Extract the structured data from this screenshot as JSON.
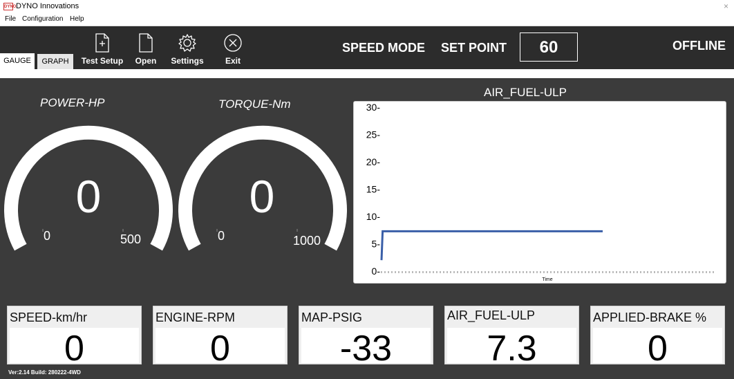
{
  "window": {
    "title": "DYNO Innovations",
    "logo_text": "DYNO",
    "close_glyph": "×"
  },
  "menu": [
    "File",
    "Configuration",
    "Help"
  ],
  "tabs": [
    {
      "label": "GAUGE",
      "active": true
    },
    {
      "label": "GRAPH",
      "active": false
    }
  ],
  "toolbar": {
    "test_setup": {
      "label": "Test Setup",
      "icon": "new-file-icon"
    },
    "open": {
      "label": "Open",
      "icon": "file-icon"
    },
    "settings": {
      "label": "Settings",
      "icon": "gear-icon"
    },
    "exit": {
      "label": "Exit",
      "icon": "close-circle-icon"
    }
  },
  "mode": {
    "label": "SPEED MODE",
    "setpoint_label": "SET POINT",
    "setpoint_value": "60"
  },
  "status": "OFFLINE",
  "gauges": [
    {
      "title": "POWER-HP",
      "value": "0",
      "min": "0",
      "max": "500"
    },
    {
      "title": "TORQUE-Nm",
      "value": "0",
      "min": "0",
      "max": "1000"
    }
  ],
  "chart_data": {
    "type": "line",
    "title": "AIR_FUEL-ULP",
    "xlabel": "Time",
    "ylabel": "",
    "ylim": [
      0,
      30
    ],
    "yticks": [
      "0-",
      "5-",
      "10-",
      "15-",
      "20-",
      "25-",
      "30-"
    ],
    "grid": false,
    "series": [
      {
        "color": "#3a5fa8",
        "x": [
          0,
          0.1,
          1,
          20
        ],
        "y": [
          2,
          7.3,
          7.3,
          7.3
        ]
      }
    ],
    "xlim": [
      0,
      30
    ]
  },
  "readouts": [
    {
      "label": "SPEED-km/hr",
      "value": "0"
    },
    {
      "label": "ENGINE-RPM",
      "value": "0"
    },
    {
      "label": "MAP-PSIG",
      "value": "-33"
    },
    {
      "label": "AIR_FUEL-ULP",
      "value": "7.3"
    },
    {
      "label": "APPLIED-BRAKE %",
      "value": "0"
    }
  ],
  "version": "Ver:2.14 Build: 280222-4WD",
  "colors": {
    "background": "#3b3b3b",
    "toolbar": "#2c2c2c",
    "series": "#3a5fa8",
    "gauge_arc": "#ffffff"
  }
}
